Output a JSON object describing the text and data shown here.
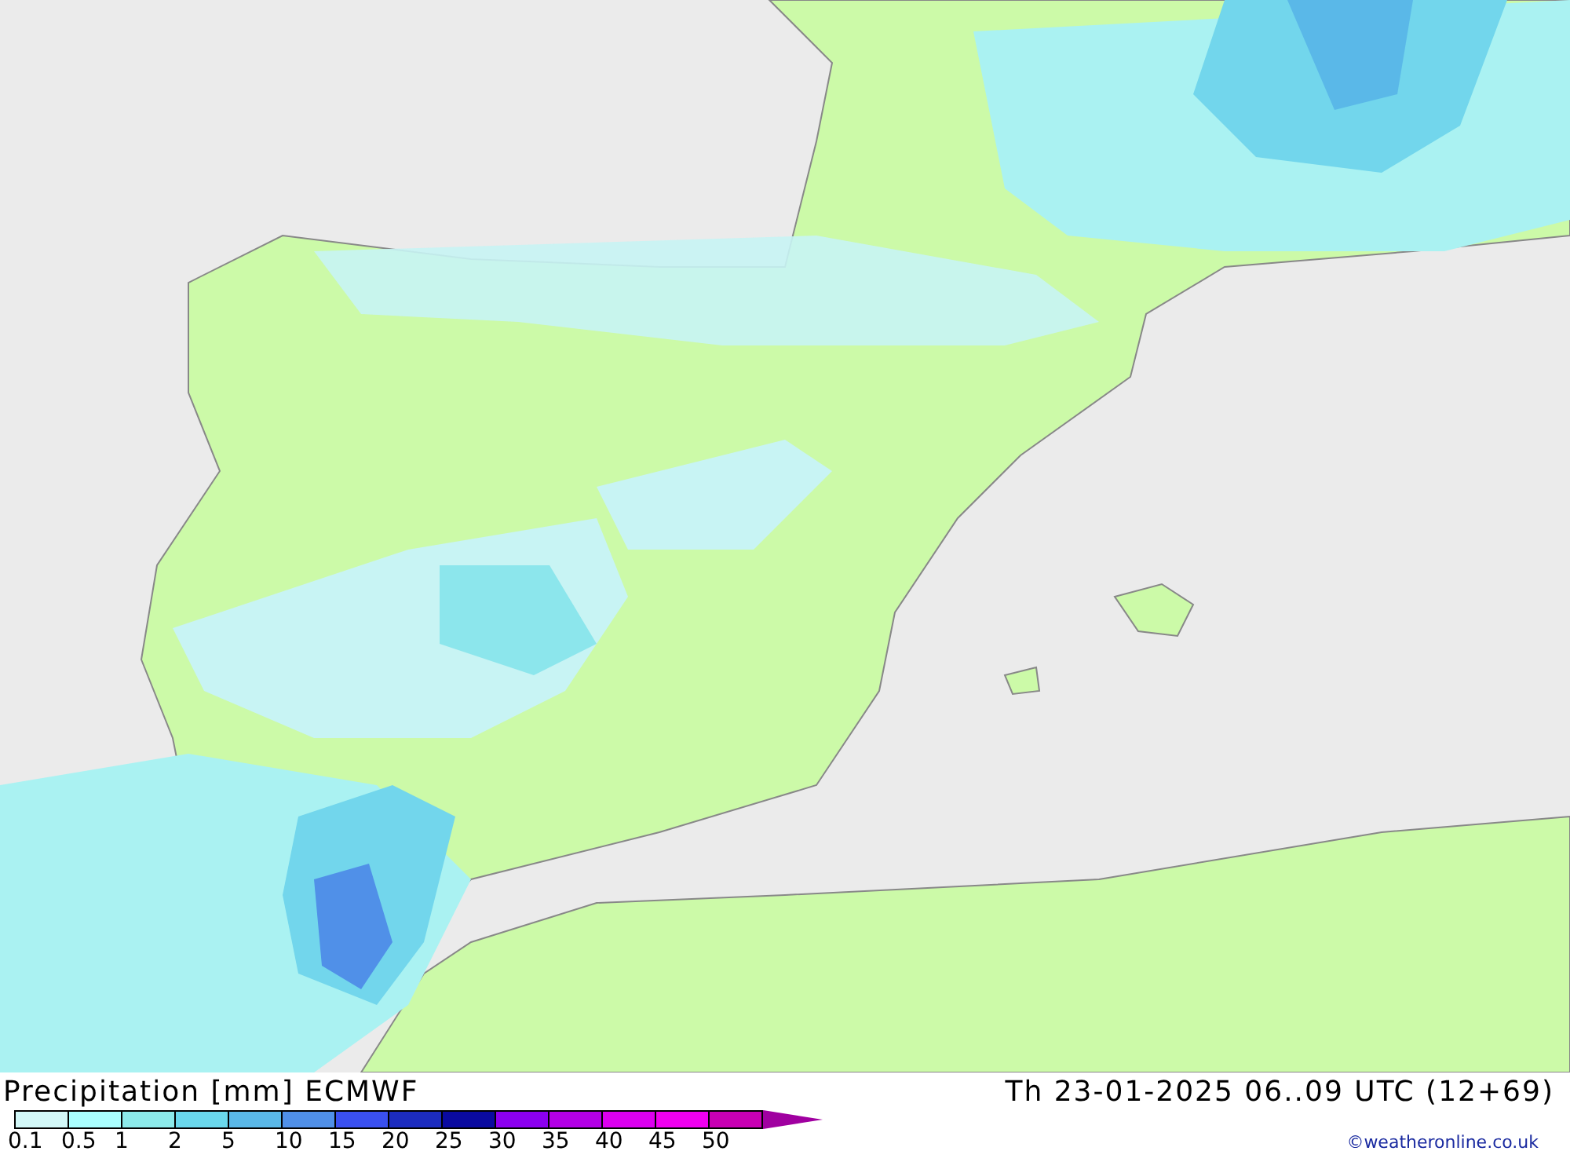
{
  "title": "Precipitation [mm] ECMWF",
  "valid_time": "Th 23-01-2025 06..09 UTC (12+69)",
  "legend": {
    "swatches": [
      {
        "color": "#d2f8f8"
      },
      {
        "color": "#aaffff"
      },
      {
        "color": "#8ceaea"
      },
      {
        "color": "#6ad8ec"
      },
      {
        "color": "#5ab8e8"
      },
      {
        "color": "#5090e8"
      },
      {
        "color": "#3a50f0"
      },
      {
        "color": "#1c2cc0"
      },
      {
        "color": "#0a0aa0"
      },
      {
        "color": "#8c00f0"
      },
      {
        "color": "#b400e6"
      },
      {
        "color": "#dc00f0"
      },
      {
        "color": "#f000f0"
      },
      {
        "color": "#c800b4"
      }
    ],
    "labels": [
      "0.1",
      "0.5",
      "1",
      "2",
      "5",
      "10",
      "15",
      "20",
      "25",
      "30",
      "35",
      "40",
      "45",
      "50"
    ]
  },
  "credit": "©weatheronline.co.uk"
}
